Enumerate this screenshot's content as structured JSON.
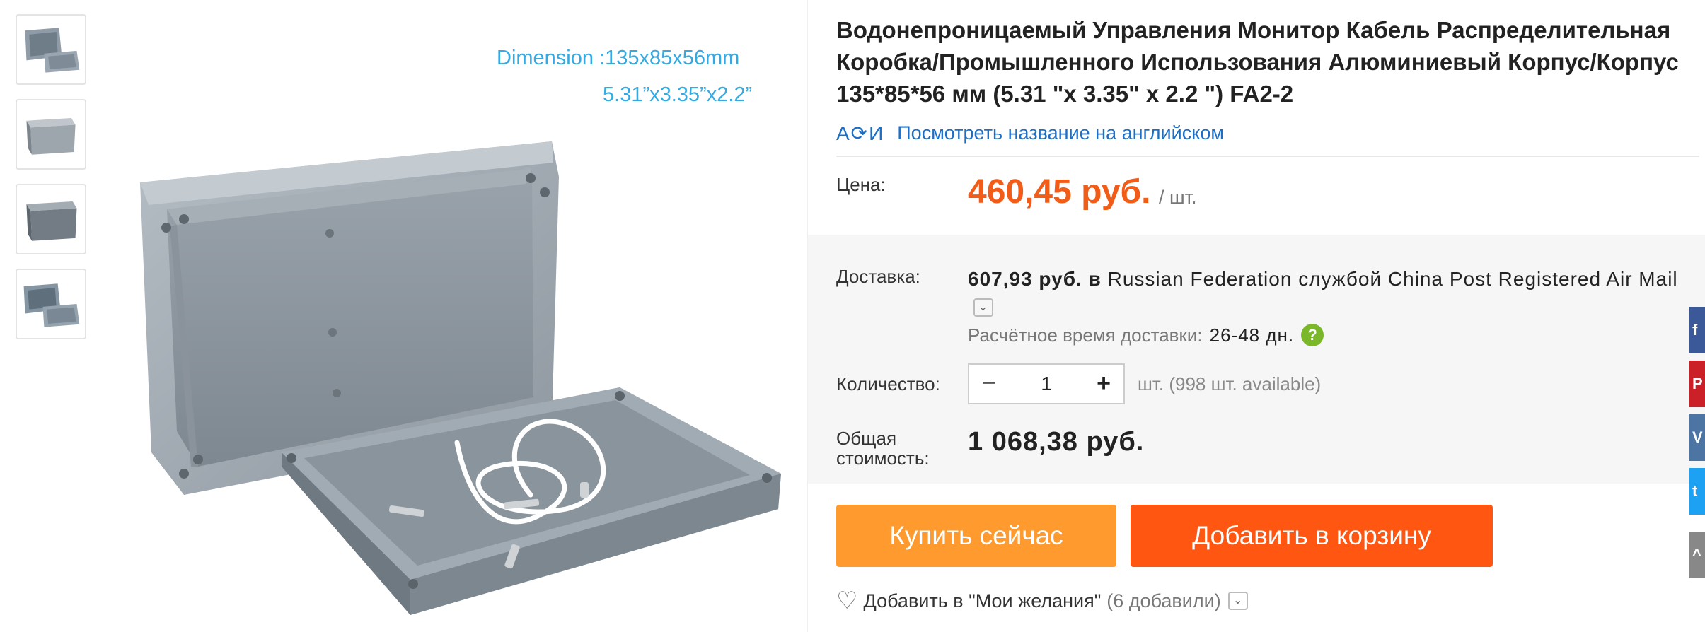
{
  "gallery": {
    "dimension_line1": "Dimension :135x85x56mm",
    "dimension_line2": "5.31”x3.35”x2.2”"
  },
  "product": {
    "title": "Водонепроницаемый Управления Монитор Кабель Распределительная Коробка/Промышленного Использования Алюминиевый Корпус/Корпус 135*85*56 мм (5.31 \"x 3.35\" x 2.2 \") FA2-2",
    "translate_icon": "A⟳И",
    "translate_link": "Посмотреть название на английском"
  },
  "price": {
    "label": "Цена:",
    "value": "460,45 руб.",
    "unit": "/ шт."
  },
  "shipping": {
    "label": "Доставка:",
    "cost": "607,93 руб.",
    "in_word": "в",
    "country": "Russian Federation",
    "service_word": "службой",
    "carrier": "China Post Registered Air Mail",
    "eta_label": "Расчётное время доставки:",
    "eta_value": "26-48 дн.",
    "help_icon": "?"
  },
  "quantity": {
    "label": "Количество:",
    "minus": "−",
    "value": "1",
    "plus": "+",
    "available": "шт. (998 шт. available)"
  },
  "total": {
    "label": "Общая стоимость:",
    "value": "1 068,38 руб."
  },
  "actions": {
    "buy_now": "Купить сейчас",
    "add_to_cart": "Добавить в корзину"
  },
  "wishlist": {
    "heart_icon": "♡",
    "label": "Добавить в \"Мои желания\"",
    "count": "(6 добавили)",
    "dropdown_icon": "⌄"
  },
  "social": {
    "facebook": "f",
    "pinterest": "P",
    "vk": "V",
    "twitter": "t",
    "scroll_up": "^"
  }
}
